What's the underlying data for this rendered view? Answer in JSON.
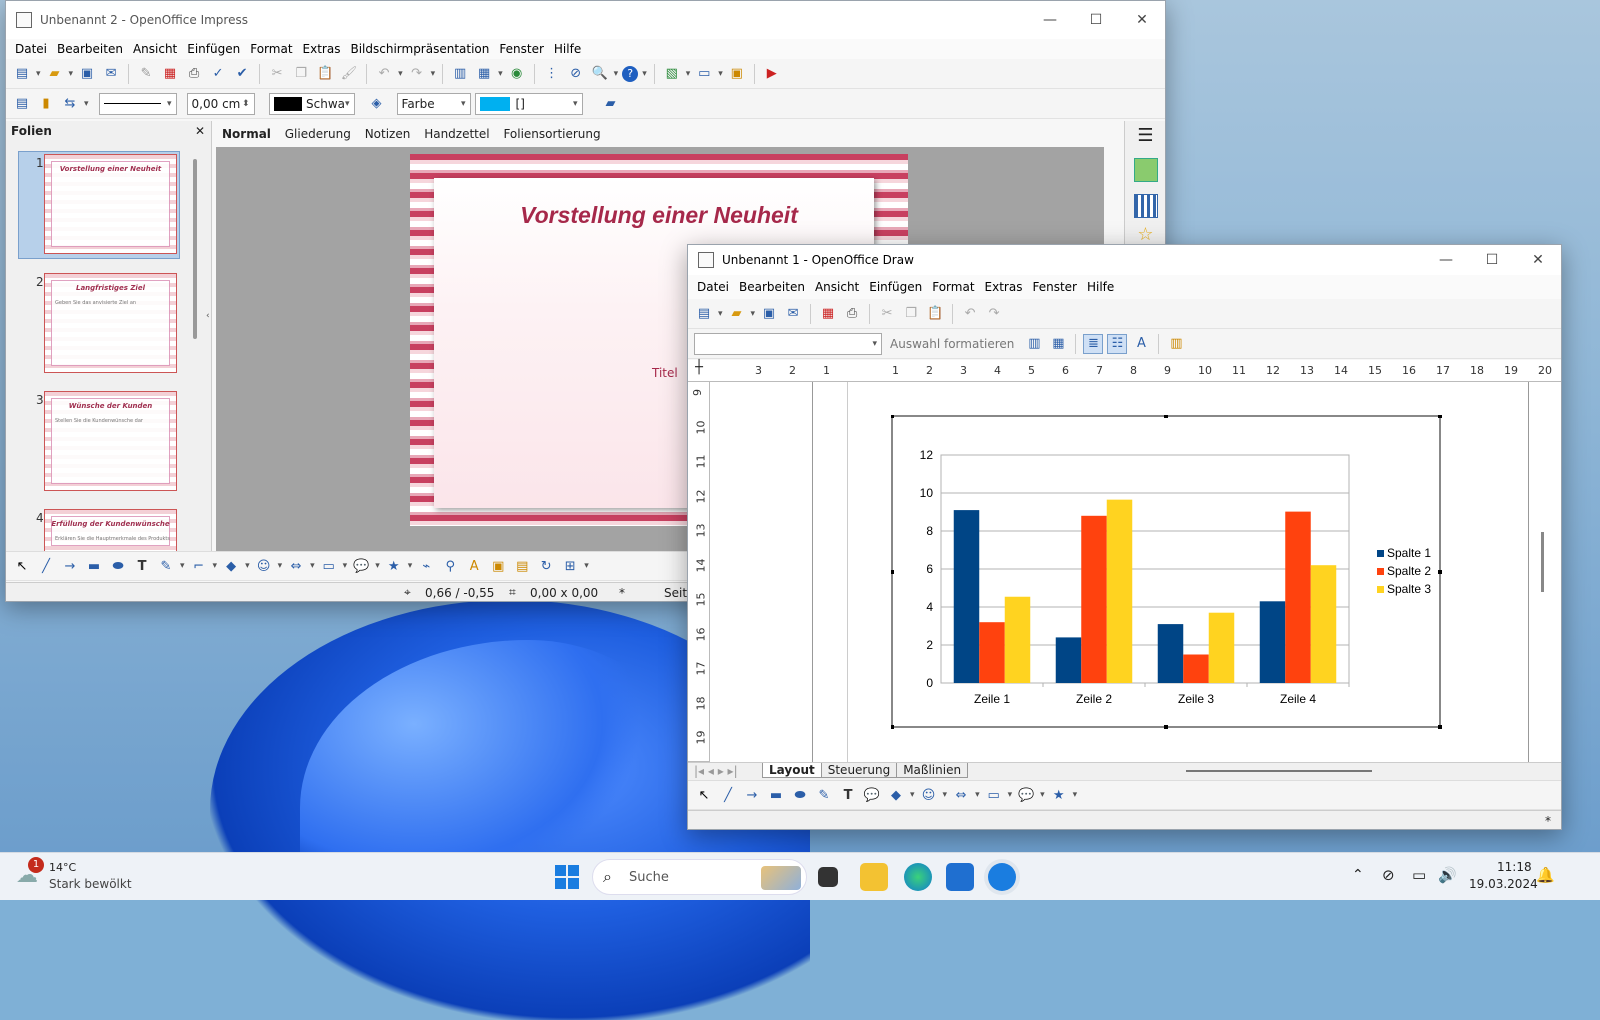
{
  "impress": {
    "title": "Unbenannt 2 - OpenOffice Impress",
    "menu": [
      "Datei",
      "Bearbeiten",
      "Ansicht",
      "Einfügen",
      "Format",
      "Extras",
      "Bildschirmpräsentation",
      "Fenster",
      "Hilfe"
    ],
    "line_width": "0,00 cm",
    "line_color": "Schwa",
    "fill_type": "Farbe",
    "fill_value": "[]",
    "slides_panel_title": "Folien",
    "view_tabs": [
      "Normal",
      "Gliederung",
      "Notizen",
      "Handzettel",
      "Foliensortierung"
    ],
    "active_tab": "Normal",
    "slide_title": "Vorstellung einer Neuheit",
    "slide_placeholder": "Titel",
    "slides": [
      {
        "num": "1",
        "title": "Vorstellung einer Neuheit",
        "body": ""
      },
      {
        "num": "2",
        "title": "Langfristiges Ziel",
        "body": "Geben Sie das anvisierte Ziel an"
      },
      {
        "num": "3",
        "title": "Wünsche der Kunden",
        "body": "Stellen Sie die Kundenwünsche dar"
      },
      {
        "num": "4",
        "title": "Erfüllung der Kundenwünsche",
        "body": "Erklären Sie die Hauptmerkmale des Produkts"
      }
    ],
    "status_pos": "0,66 / -0,55",
    "status_size": "0,00 x 0,00",
    "status_mod": "*",
    "status_page": "Seite"
  },
  "draw": {
    "title": "Unbenannt 1 - OpenOffice Draw",
    "menu": [
      "Datei",
      "Bearbeiten",
      "Ansicht",
      "Einfügen",
      "Format",
      "Extras",
      "Fenster",
      "Hilfe"
    ],
    "format_selection": "Auswahl formatieren",
    "sheet_tabs": [
      "Layout",
      "Steuerung",
      "Maßlinien"
    ],
    "active_sheet": "Layout",
    "ruler_h": [
      "3",
      "2",
      "1",
      "1",
      "2",
      "3",
      "4",
      "5",
      "6",
      "7",
      "8",
      "9",
      "10",
      "11",
      "12",
      "13",
      "14",
      "15",
      "16",
      "17",
      "18",
      "19",
      "20"
    ],
    "ruler_v": [
      "9",
      "10",
      "11",
      "12",
      "13",
      "14",
      "15",
      "16",
      "17",
      "18",
      "19"
    ],
    "status_mod": "*"
  },
  "chart_data": {
    "type": "bar",
    "categories": [
      "Zeile 1",
      "Zeile 2",
      "Zeile 3",
      "Zeile 4"
    ],
    "series": [
      {
        "name": "Spalte 1",
        "values": [
          9.1,
          2.4,
          3.1,
          4.3
        ],
        "color": "#004586"
      },
      {
        "name": "Spalte 2",
        "values": [
          3.2,
          8.8,
          1.5,
          9.02
        ],
        "color": "#ff420e"
      },
      {
        "name": "Spalte 3",
        "values": [
          4.54,
          9.65,
          3.7,
          6.2
        ],
        "color": "#ffd320"
      }
    ],
    "ylim": [
      0,
      12
    ],
    "yticks": [
      "0",
      "2",
      "4",
      "6",
      "8",
      "10",
      "12"
    ],
    "legend": "right",
    "grid": true
  },
  "taskbar": {
    "temperature": "14°C",
    "weather": "Stark bewölkt",
    "weather_badge": "1",
    "search": "Suche",
    "time": "11:18",
    "date": "19.03.2024"
  }
}
